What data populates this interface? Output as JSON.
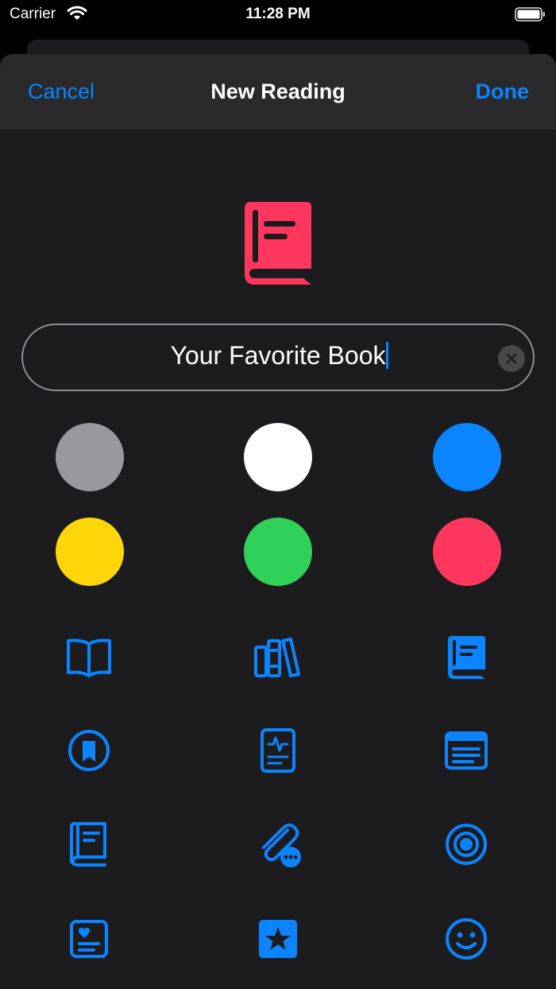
{
  "status_bar": {
    "carrier": "Carrier",
    "time": "11:28 PM"
  },
  "nav": {
    "cancel_label": "Cancel",
    "title": "New Reading",
    "done_label": "Done"
  },
  "name_field": {
    "value": "Your Favorite Book"
  },
  "accent_color": "#0a84ff",
  "selected_color": "#ff375f",
  "colors": [
    "#98989d",
    "#ffffff",
    "#0a84ff",
    "#ffd60a",
    "#30d158",
    "#ff375f"
  ],
  "icons": [
    "book-open-icon",
    "books-vertical-icon",
    "book-closed-icon",
    "bookmark-circle-icon",
    "waveform-doc-icon",
    "newspaper-icon",
    "book-closed-outline-icon",
    "paperclip-more-icon",
    "target-icon",
    "heart-text-doc-icon",
    "star-square-icon",
    "smiley-icon"
  ]
}
